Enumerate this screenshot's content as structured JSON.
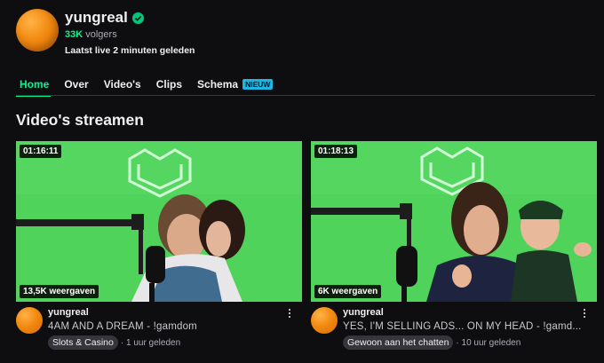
{
  "channel": {
    "name": "yungreal",
    "followers_count": "33K",
    "followers_label": "volgers",
    "live_status": "Laatst live 2 minuten geleden"
  },
  "tabs": [
    {
      "label": "Home",
      "active": true
    },
    {
      "label": "Over"
    },
    {
      "label": "Video's"
    },
    {
      "label": "Clips"
    },
    {
      "label": "Schema",
      "badge": "NIEUW"
    }
  ],
  "section_title": "Video's streamen",
  "videos": [
    {
      "duration": "01:16:11",
      "views": "13,5K weergaven",
      "channel": "yungreal",
      "title": "4AM AND A DREAM - !gamdom",
      "category": "Slots & Casino",
      "ago": "· 1 uur geleden"
    },
    {
      "duration": "01:18:13",
      "views": "6K weergaven",
      "channel": "yungreal",
      "title": "YES, I'M SELLING ADS... ON MY HEAD - !gamd...",
      "category": "Gewoon aan het chatten",
      "ago": "· 10 uur geleden"
    }
  ],
  "colors": {
    "background": "#0e0e10",
    "accent_green": "#00f593",
    "badge_blue": "#1fb5e0",
    "greenscreen": "#4dd65a"
  },
  "icons": {
    "verified": "verified-check-icon",
    "more": "more-vertical-icon"
  }
}
